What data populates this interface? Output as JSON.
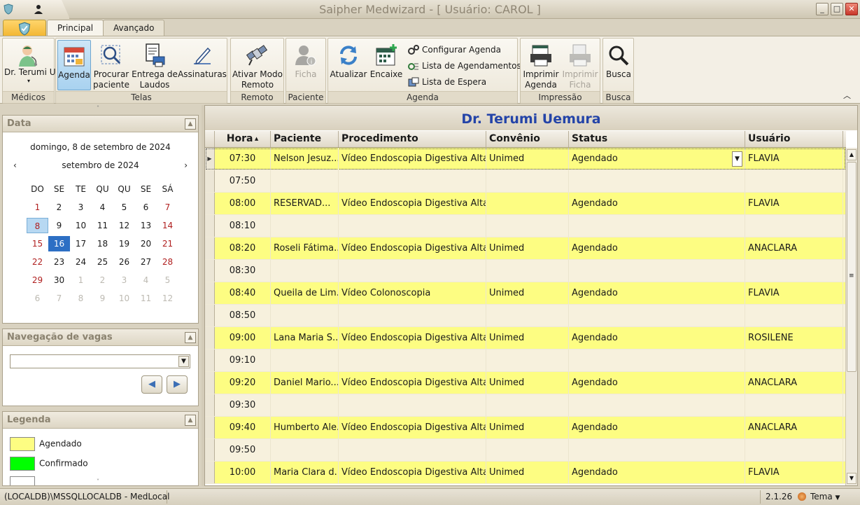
{
  "window": {
    "title": "Saipher Medwizard - [ Usuário: CAROL ]",
    "buttons": {
      "minimize": "_",
      "maximize": "□",
      "close": "✕"
    }
  },
  "tabs": [
    {
      "label": "Principal",
      "active": true
    },
    {
      "label": "Avançado",
      "active": false
    }
  ],
  "ribbon": {
    "groups": {
      "medicos": {
        "label": "Médicos",
        "doctor_button": "Dr. Terumi Uemura"
      },
      "telas": {
        "label": "Telas",
        "agenda": "Agenda",
        "procurar": "Procurar paciente",
        "entrega": "Entrega de Laudos",
        "assinaturas": "Assinaturas"
      },
      "remoto": {
        "label": "Remoto",
        "ativar": "Ativar Modo Remoto"
      },
      "paciente": {
        "label": "Paciente",
        "ficha": "Ficha"
      },
      "agenda": {
        "label": "Agenda",
        "atualizar": "Atualizar",
        "encaixe": "Encaixe",
        "configurar": "Configurar Agenda",
        "lista_agendamentos": "Lista de Agendamentos",
        "lista_espera": "Lista de Espera"
      },
      "impressao": {
        "label": "Impressão",
        "imprimir_agenda": "Imprimir Agenda",
        "imprimir_ficha": "Imprimir Ficha"
      },
      "busca": {
        "label": "Busca",
        "busca": "Busca"
      }
    }
  },
  "left": {
    "data_panel": {
      "title": "Data",
      "selected_date_text": "domingo, 8 de setembro de 2024",
      "month": "setembro de 2024",
      "weekdays": [
        "DO",
        "SE",
        "TE",
        "QU",
        "QU",
        "SE",
        "SÁ"
      ],
      "weeks": [
        [
          "1",
          "2",
          "3",
          "4",
          "5",
          "6",
          "7"
        ],
        [
          "8",
          "9",
          "10",
          "11",
          "12",
          "13",
          "14"
        ],
        [
          "15",
          "16",
          "17",
          "18",
          "19",
          "20",
          "21"
        ],
        [
          "22",
          "23",
          "24",
          "25",
          "26",
          "27",
          "28"
        ],
        [
          "29",
          "30",
          "1",
          "2",
          "3",
          "4",
          "5"
        ],
        [
          "6",
          "7",
          "8",
          "9",
          "10",
          "11",
          "12"
        ]
      ],
      "selected_day": "8",
      "today_day": "16"
    },
    "navegacao_panel": {
      "title": "Navegação de vagas",
      "combo_value": ""
    },
    "legenda_panel": {
      "title": "Legenda",
      "items": [
        {
          "label": "Agendado",
          "color": "#fdfd82"
        },
        {
          "label": "Confirmado",
          "color": "#00ff00"
        }
      ]
    }
  },
  "main": {
    "doctor_title": "Dr. Terumi Uemura",
    "columns": [
      "Hora",
      "Paciente",
      "Procedimento",
      "Convênio",
      "Status",
      "Usuário"
    ],
    "rows": [
      {
        "hora": "07:30",
        "paciente": "Nelson Jesuz...",
        "procedimento": "Vídeo Endoscopia Digestiva Alta",
        "convenio": "Unimed",
        "status": "Agendado",
        "usuario": "FLAVIA"
      },
      {
        "hora": "07:50",
        "paciente": "",
        "procedimento": "",
        "convenio": "",
        "status": "",
        "usuario": ""
      },
      {
        "hora": "08:00",
        "paciente": "RESERVAD...",
        "procedimento": "Vídeo Endoscopia Digestiva Alta",
        "convenio": "",
        "status": "Agendado",
        "usuario": "FLAVIA"
      },
      {
        "hora": "08:10",
        "paciente": "",
        "procedimento": "",
        "convenio": "",
        "status": "",
        "usuario": ""
      },
      {
        "hora": "08:20",
        "paciente": "Roseli Fátima...",
        "procedimento": "Vídeo Endoscopia Digestiva Alta",
        "convenio": "Unimed",
        "status": "Agendado",
        "usuario": "ANACLARA"
      },
      {
        "hora": "08:30",
        "paciente": "",
        "procedimento": "",
        "convenio": "",
        "status": "",
        "usuario": ""
      },
      {
        "hora": "08:40",
        "paciente": "Queila de Lim...",
        "procedimento": "Vídeo Colonoscopia",
        "convenio": "Unimed",
        "status": "Agendado",
        "usuario": "FLAVIA"
      },
      {
        "hora": "08:50",
        "paciente": "",
        "procedimento": "",
        "convenio": "",
        "status": "",
        "usuario": ""
      },
      {
        "hora": "09:00",
        "paciente": "Lana Maria S...",
        "procedimento": "Vídeo Endoscopia Digestiva Alta",
        "convenio": "Unimed",
        "status": "Agendado",
        "usuario": "ROSILENE"
      },
      {
        "hora": "09:10",
        "paciente": "",
        "procedimento": "",
        "convenio": "",
        "status": "",
        "usuario": ""
      },
      {
        "hora": "09:20",
        "paciente": "Daniel Mario...",
        "procedimento": "Vídeo Endoscopia Digestiva Alta",
        "convenio": "Unimed",
        "status": "Agendado",
        "usuario": "ANACLARA"
      },
      {
        "hora": "09:30",
        "paciente": "",
        "procedimento": "",
        "convenio": "",
        "status": "",
        "usuario": ""
      },
      {
        "hora": "09:40",
        "paciente": "Humberto Ale...",
        "procedimento": "Vídeo Endoscopia Digestiva Alta",
        "convenio": "Unimed",
        "status": "Agendado",
        "usuario": "ANACLARA"
      },
      {
        "hora": "09:50",
        "paciente": "",
        "procedimento": "",
        "convenio": "",
        "status": "",
        "usuario": ""
      },
      {
        "hora": "10:00",
        "paciente": "Maria Clara d...",
        "procedimento": "Vídeo Endoscopia Digestiva Alta",
        "convenio": "Unimed",
        "status": "Agendado",
        "usuario": "FLAVIA"
      }
    ]
  },
  "statusbar": {
    "connection": "(LOCALDB)\\MSSQLLOCALDB - MedLocal",
    "version": "2.1.26",
    "theme_label": "Tema"
  }
}
